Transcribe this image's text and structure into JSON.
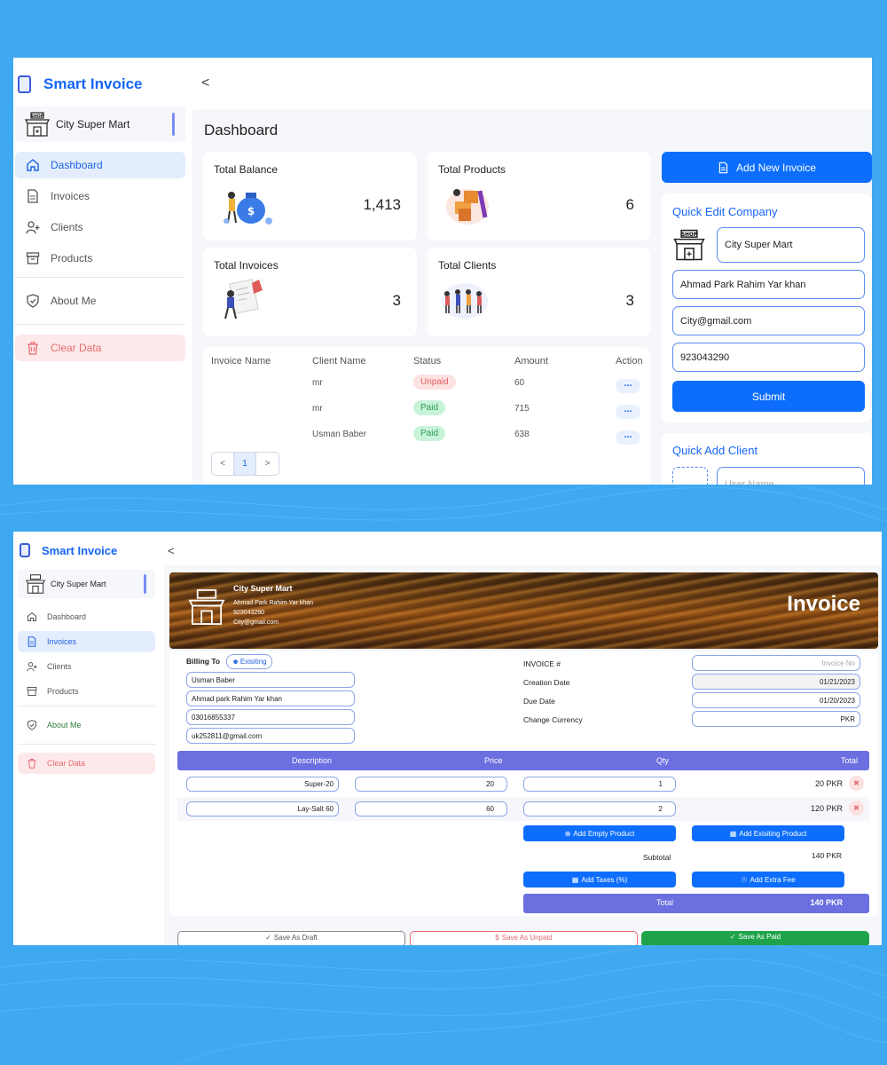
{
  "top": {
    "app_name": "Smart Invoice",
    "back": "<",
    "shop_name": "City Super Mart",
    "nav": {
      "dashboard": "Dashboard",
      "invoices": "Invoices",
      "clients": "Clients",
      "products": "Products",
      "about": "About Me",
      "clear": "Clear Data"
    },
    "page_title": "Dashboard",
    "cards": {
      "balance": {
        "label": "Total Balance",
        "value": "1,413"
      },
      "products": {
        "label": "Total Products",
        "value": "6"
      },
      "invoices": {
        "label": "Total Invoices",
        "value": "3"
      },
      "clients": {
        "label": "Total Clients",
        "value": "3"
      }
    },
    "table": {
      "headers": [
        "Invoice Name",
        "Client Name",
        "Status",
        "Amount",
        "Action"
      ],
      "rows": [
        {
          "client": "mr",
          "status": "Unpaid",
          "amount": "60"
        },
        {
          "client": "mr",
          "status": "Paid",
          "amount": "715"
        },
        {
          "client": "Usman Baber",
          "status": "Paid",
          "amount": "638"
        }
      ],
      "pager": {
        "prev": "<",
        "page": "1",
        "next": ">"
      }
    },
    "add_invoice": "Add New Invoice",
    "quick_edit": {
      "title": "Quick Edit Company",
      "name": "City Super Mart",
      "address": "Ahmad Park Rahim Yar khan",
      "email": "City@gmail.com",
      "phone": "923043290",
      "submit": "Submit"
    },
    "quick_add": {
      "title": "Quick Add Client",
      "placeholder": "User Name"
    }
  },
  "bottom": {
    "app_name": "Smart Invoice",
    "back": "<",
    "shop_name": "City Super Mart",
    "nav": {
      "dashboard": "Dashboard",
      "invoices": "Invoices",
      "clients": "Clients",
      "products": "Products",
      "about": "About Me",
      "clear": "Clear Data"
    },
    "header": {
      "company": "City Super Mart",
      "address": "Ahmad Park Rahim Yar khan",
      "phone": "923043290",
      "email": "City@gmail.com",
      "title": "Invoice"
    },
    "billing": {
      "label": "Billing To",
      "existing": "Exisiting",
      "name": "Usman Baber",
      "address": "Ahmad park Rahim Yar khan",
      "phone": "03016855337",
      "email": "uk252811@gmail.com"
    },
    "meta": {
      "invoice_no_label": "INVOICE #",
      "invoice_no_placeholder": "Invoice No",
      "creation_label": "Creation Date",
      "creation_value": "01/21/2023",
      "due_label": "Due Date",
      "due_value": "01/20/2023",
      "currency_label": "Change Currency",
      "currency_value": "PKR"
    },
    "items_header": [
      "Description",
      "Price",
      "Qty",
      "Total"
    ],
    "items": [
      {
        "desc": "Super-20",
        "price": "20",
        "qty": "1",
        "total": "20 PKR"
      },
      {
        "desc": "Lay-Salt 60",
        "price": "60",
        "qty": "2",
        "total": "120 PKR"
      }
    ],
    "buttons": {
      "add_empty": "Add Empty Product",
      "add_existing": "Add Exisiting Product",
      "add_taxes": "Add Taxes (%)",
      "add_fee": "Add Extra Fee",
      "draft": "Save As Draft",
      "unpaid": "Save As Unpaid",
      "paid": "Save As Paid"
    },
    "subtotal_label": "Subtotal",
    "subtotal_value": "140 PKR",
    "total_label": "Total",
    "total_value": "140 PKR"
  },
  "colors": {
    "accent": "#0d6efd",
    "brand": "#1565f5",
    "purple": "#6b6fe0",
    "danger": "#e56b6f",
    "success": "#1fa34a",
    "background": "#3ea9f0"
  }
}
